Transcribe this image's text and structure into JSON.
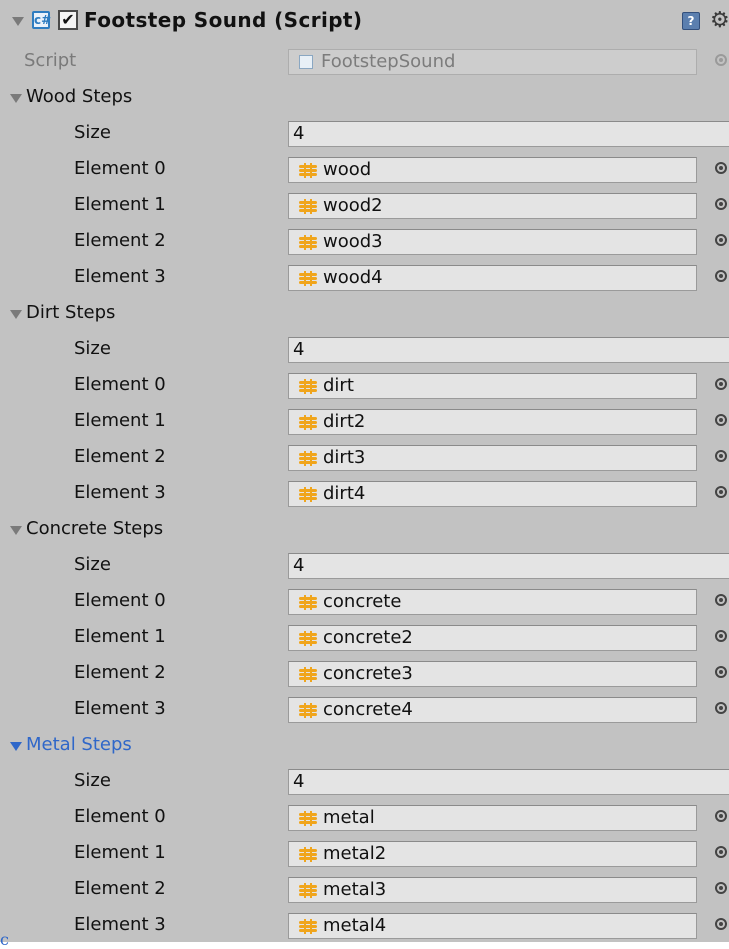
{
  "component": {
    "title": "Footstep Sound (Script)",
    "enabled_check": "✔",
    "script_icon": "c#",
    "help_icon": "?",
    "gear_icon": "⚙"
  },
  "script_row": {
    "label": "Script",
    "value": "FootstepSound"
  },
  "size_label": "Size",
  "sections": [
    {
      "name": "Wood Steps",
      "size": "4",
      "elements": [
        {
          "label": "Element 0",
          "value": "wood"
        },
        {
          "label": "Element 1",
          "value": "wood2"
        },
        {
          "label": "Element 2",
          "value": "wood3"
        },
        {
          "label": "Element 3",
          "value": "wood4"
        }
      ]
    },
    {
      "name": "Dirt Steps",
      "size": "4",
      "elements": [
        {
          "label": "Element 0",
          "value": "dirt"
        },
        {
          "label": "Element 1",
          "value": "dirt2"
        },
        {
          "label": "Element 2",
          "value": "dirt3"
        },
        {
          "label": "Element 3",
          "value": "dirt4"
        }
      ]
    },
    {
      "name": "Concrete Steps",
      "size": "4",
      "elements": [
        {
          "label": "Element 0",
          "value": "concrete"
        },
        {
          "label": "Element 1",
          "value": "concrete2"
        },
        {
          "label": "Element 2",
          "value": "concrete3"
        },
        {
          "label": "Element 3",
          "value": "concrete4"
        }
      ]
    },
    {
      "name": "Metal Steps",
      "size": "4",
      "active": true,
      "elements": [
        {
          "label": "Element 0",
          "value": "metal"
        },
        {
          "label": "Element 1",
          "value": "metal2"
        },
        {
          "label": "Element 2",
          "value": "metal3"
        },
        {
          "label": "Element 3",
          "value": "metal4"
        }
      ]
    }
  ],
  "colors": {
    "panel": "#c2c2c2",
    "field": "#e4e4e4",
    "active_section": "#2f67c9",
    "audio_icon": "#f0a51c"
  },
  "footer": {
    "stray_text": "c"
  }
}
